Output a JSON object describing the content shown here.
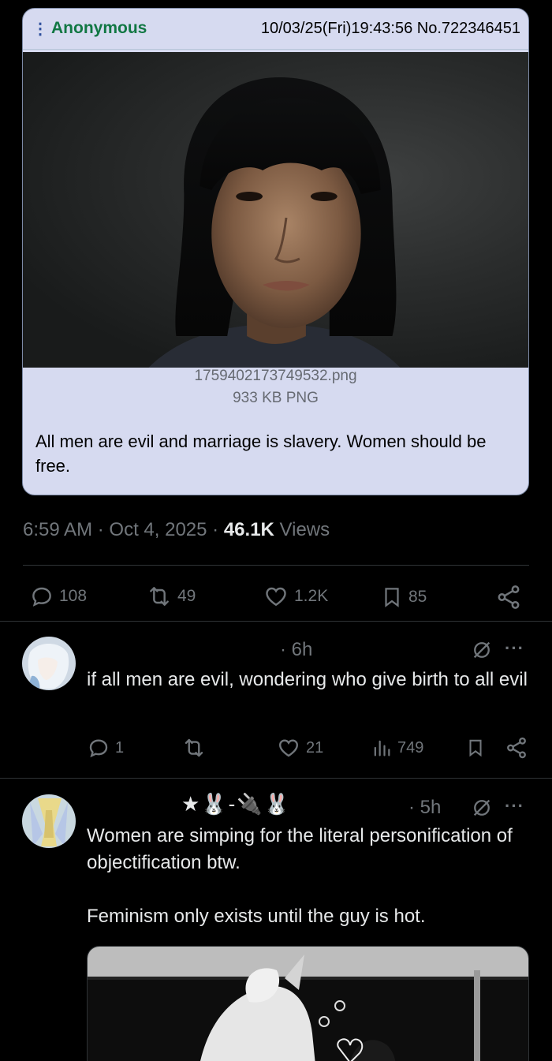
{
  "quoted_post": {
    "menu_icon": "vertical-dots-icon",
    "poster_name": "Anonymous",
    "post_info": "10/03/25(Fri)19:43:56 No.722346451",
    "file_name": "1759402173749532.png",
    "file_size": "933 KB PNG",
    "comment": "All men are evil and marriage is slavery. Women should be free."
  },
  "tweet": {
    "time": "6:59 AM",
    "date": "Oct 4, 2025",
    "views_count": "46.1K",
    "views_label": "Views",
    "replies": "108",
    "reposts": "49",
    "likes": "1.2K",
    "bookmarks": "85"
  },
  "replies": [
    {
      "time": "· 6h",
      "text": "if all men are evil, wondering who give birth to all evil",
      "replies": "1",
      "likes": "21",
      "views": "749"
    },
    {
      "display_name": "★🐰-🔌🐰",
      "time": "· 5h",
      "text": "Women are simping for the literal personification of objectification btw.\n\nFeminism only exists until the guy is hot."
    }
  ],
  "icons": {
    "reply": "speech-bubble-icon",
    "repost": "repost-arrows-icon",
    "like": "heart-icon",
    "bookmark": "bookmark-icon",
    "share": "share-icon",
    "views": "bar-chart-icon",
    "grok": "slashed-circle-icon",
    "more": "ellipsis-icon"
  },
  "colors": {
    "background": "#000000",
    "card_bg": "#d6daf0",
    "poster_green": "#117743",
    "muted_text": "#71767b",
    "divider": "#2f3336"
  }
}
